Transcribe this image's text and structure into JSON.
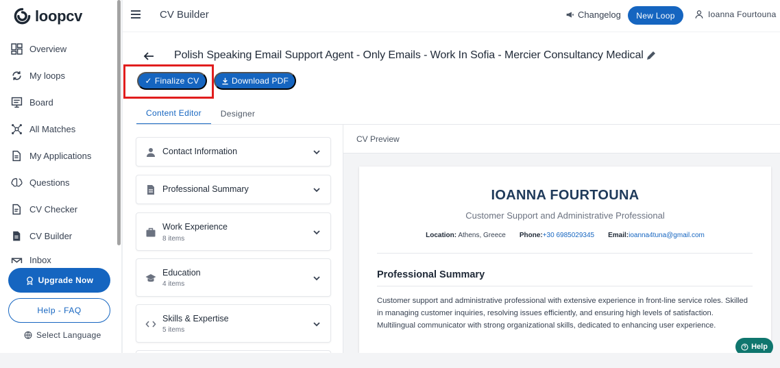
{
  "app": {
    "logo_text": "loopcv"
  },
  "sidebar": {
    "items": [
      {
        "label": "Overview",
        "icon": "dashboard-icon"
      },
      {
        "label": "My loops",
        "icon": "loop-icon"
      },
      {
        "label": "Board",
        "icon": "board-icon"
      },
      {
        "label": "All Matches",
        "icon": "network-icon"
      },
      {
        "label": "My Applications",
        "icon": "documents-icon"
      },
      {
        "label": "Questions",
        "icon": "brain-icon"
      },
      {
        "label": "CV Checker",
        "icon": "cv-checker-icon"
      },
      {
        "label": "CV Builder",
        "icon": "cv-builder-icon"
      },
      {
        "label": "Inbox",
        "icon": "inbox-icon"
      }
    ],
    "upgrade_label": "Upgrade Now",
    "help_faq_label": "Help - FAQ",
    "language_label": "Select Language"
  },
  "topbar": {
    "title": "CV Builder",
    "changelog_label": "Changelog",
    "new_loop_label": "New Loop",
    "user_name": "Ioanna Fourtouna"
  },
  "main": {
    "heading": "Polish Speaking Email Support Agent - Only Emails - Work In Sofia - Mercier Consultancy Medical",
    "finalize_label": "Finalize CV",
    "download_label": "Download PDF",
    "tabs": [
      {
        "label": "Content Editor",
        "active": true
      },
      {
        "label": "Designer",
        "active": false
      }
    ],
    "sections": [
      {
        "title": "Contact Information",
        "sub": "",
        "icon": "person-icon"
      },
      {
        "title": "Professional Summary",
        "sub": "",
        "icon": "document-icon"
      },
      {
        "title": "Work Experience",
        "sub": "8 items",
        "icon": "briefcase-icon"
      },
      {
        "title": "Education",
        "sub": "4 items",
        "icon": "graduation-cap-icon"
      },
      {
        "title": "Skills & Expertise",
        "sub": "5 items",
        "icon": "code-icon"
      }
    ]
  },
  "preview": {
    "label": "CV Preview",
    "name": "IOANNA FOURTOUNA",
    "role": "Customer Support and Administrative Professional",
    "location_label": "Location:",
    "location": "Athens, Greece",
    "phone_label": "Phone:",
    "phone": "+30 6985029345",
    "email_label": "Email:",
    "email": "ioanna4tuna@gmail.com",
    "section_title": "Professional Summary",
    "summary": "Customer support and administrative professional with extensive experience in front-line service roles. Skilled in managing customer inquiries, resolving issues efficiently, and ensuring high levels of satisfaction. Multilingual communicator with strong organizational skills, dedicated to enhancing user experience."
  },
  "help_bubble_label": "Help",
  "colors": {
    "primary": "#1565c0",
    "highlight": "#e11d1d",
    "help": "#0f766e"
  }
}
